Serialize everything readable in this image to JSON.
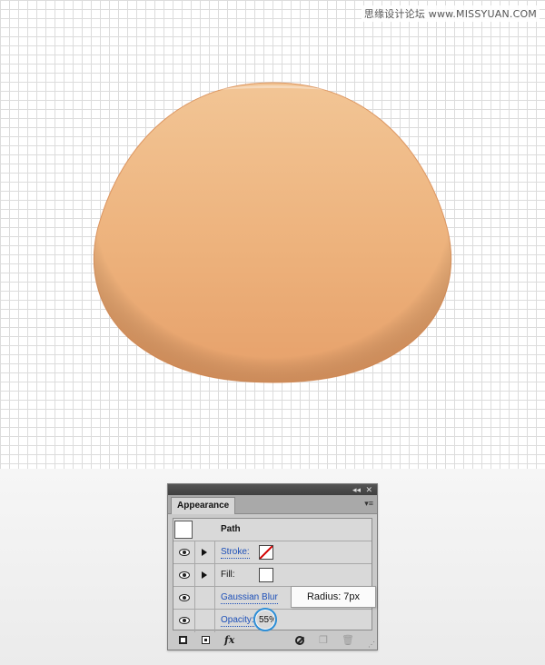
{
  "watermark": "思缘设计论坛 www.MISSYUAN.COM",
  "artwork": {
    "fill_top": "#f2c595",
    "fill_bottom": "#e6a06a",
    "rim": "#d68a52"
  },
  "panel": {
    "title": "Appearance",
    "collapse_glyph": "◂◂",
    "close_glyph": "✕",
    "menu_glyph": "▾≡",
    "rows": [
      {
        "label": "Path"
      },
      {
        "label": "Stroke:"
      },
      {
        "label": "Fill:"
      },
      {
        "label": "Gaussian Blur"
      },
      {
        "label": "Opacity:",
        "value": "55%"
      }
    ],
    "tooltip": "Radius: 7px",
    "toolbar": {
      "fx_label": "fx",
      "duplicate_glyph": "❐",
      "trash_glyph": "🗑",
      "grip_glyph": "⋰"
    }
  }
}
